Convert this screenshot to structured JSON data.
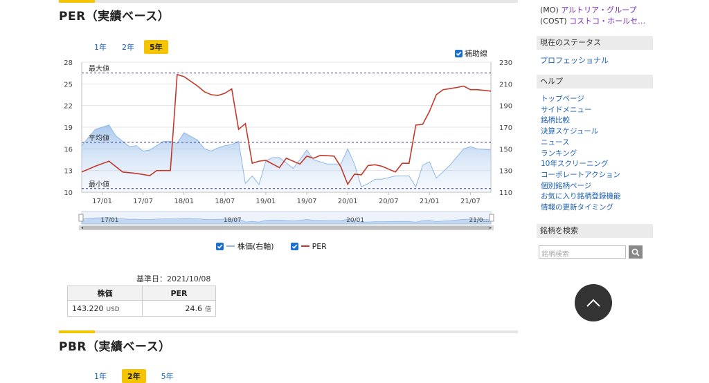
{
  "per_section": {
    "title": "PER（実績ベース）",
    "period_tabs": [
      "1年",
      "2年",
      "5年"
    ],
    "active_tab": "5年",
    "aux_line_label": "補助線",
    "legend": {
      "price": "株価(右軸)",
      "per": "PER"
    },
    "base_date": "基準日：2021/10/08",
    "table": {
      "headers": [
        "株価",
        "PER"
      ],
      "price": "143.220",
      "price_unit": "USD",
      "per": "24.6",
      "per_unit": "倍"
    }
  },
  "pbr_section": {
    "title": "PBR（実績ベース）",
    "period_tabs": [
      "1年",
      "2年",
      "5年"
    ],
    "active_tab": "2年"
  },
  "sidebar": {
    "stocks": [
      {
        "code": "(MO)",
        "name": "アルトリア・グループ"
      },
      {
        "code": "(COST)",
        "name": "コストコ・ホールセ…"
      }
    ],
    "status": {
      "title": "現在のステータス",
      "value": "プロフェッショナル"
    },
    "help": {
      "title": "ヘルプ",
      "links": [
        "トップページ",
        "サイドメニュー",
        "銘柄比較",
        "決算スケジュール",
        "ニュース",
        "ランキング",
        "10年スクリーニング",
        "コーポレートアクション",
        "個別銘柄ページ",
        "お気に入り銘柄登録機能",
        "情報の更新タイミング"
      ]
    },
    "search": {
      "title": "銘柄を検索",
      "placeholder": "銘柄検索"
    }
  },
  "colors": {
    "per_line": "#c0392b",
    "price_line": "#8fb8e8",
    "price_fill": "#dce9f9",
    "accent": "#f5c400",
    "link": "#1a5fb4"
  },
  "chart_data": {
    "type": "line",
    "x_tick_labels": [
      "17/01",
      "17/07",
      "18/01",
      "18/07",
      "19/01",
      "19/07",
      "20/01",
      "20/07",
      "21/01",
      "21/07"
    ],
    "x_range": [
      "2016-10",
      "2021-10"
    ],
    "y_left": {
      "ticks": [
        10,
        13,
        16,
        19,
        22,
        25,
        28
      ],
      "range": [
        10,
        28
      ]
    },
    "y_right": {
      "ticks": [
        110,
        130,
        150,
        170,
        190,
        210,
        230
      ],
      "range": [
        110,
        230
      ]
    },
    "reference_lines": [
      {
        "label": "最大値",
        "value": 26.5
      },
      {
        "label": "平均値",
        "value": 16.9
      },
      {
        "label": "最小値",
        "value": 10.5
      }
    ],
    "series": [
      {
        "name": "株価(右軸)",
        "axis": "right",
        "type": "area",
        "x": [
          "2016-10",
          "2016-12",
          "2017-02",
          "2017-03",
          "2017-05",
          "2017-06",
          "2017-07",
          "2017-08",
          "2017-10",
          "2017-11",
          "2017-12",
          "2018-01",
          "2018-03",
          "2018-04",
          "2018-05",
          "2018-06",
          "2018-07",
          "2018-08",
          "2018-09",
          "2018-10",
          "2018-11",
          "2018-12",
          "2019-01",
          "2019-02",
          "2019-03",
          "2019-05",
          "2019-06",
          "2019-07",
          "2019-08",
          "2019-10",
          "2019-12",
          "2020-01",
          "2020-02",
          "2020-03",
          "2020-04",
          "2020-05",
          "2020-06",
          "2020-08",
          "2020-10",
          "2020-11",
          "2020-12",
          "2021-01",
          "2021-02",
          "2021-04",
          "2021-06",
          "2021-07",
          "2021-08",
          "2021-10"
        ],
        "values": [
          153,
          168,
          172,
          162,
          152,
          153,
          148,
          149,
          157,
          157,
          155,
          165,
          158,
          150,
          148,
          151,
          153,
          154,
          157,
          118,
          125,
          117,
          139,
          142,
          142,
          132,
          140,
          149,
          140,
          136,
          136,
          150,
          136,
          115,
          118,
          122,
          122,
          125,
          125,
          115,
          135,
          138,
          123,
          135,
          150,
          152,
          150,
          149
        ]
      },
      {
        "name": "PER",
        "axis": "left",
        "type": "line",
        "x": [
          "2016-10",
          "2016-12",
          "2017-02",
          "2017-04",
          "2017-06",
          "2017-08",
          "2017-09",
          "2017-11",
          "2017-12",
          "2018-01",
          "2018-03",
          "2018-04",
          "2018-05",
          "2018-06",
          "2018-07",
          "2018-08",
          "2018-09",
          "2018-10",
          "2018-11",
          "2018-12",
          "2019-01",
          "2019-03",
          "2019-04",
          "2019-06",
          "2019-07",
          "2019-08",
          "2019-09",
          "2019-11",
          "2019-12",
          "2020-01",
          "2020-02",
          "2020-03",
          "2020-04",
          "2020-05",
          "2020-06",
          "2020-08",
          "2020-09",
          "2020-10",
          "2020-11",
          "2020-12",
          "2021-01",
          "2021-02",
          "2021-03",
          "2021-05",
          "2021-06",
          "2021-07",
          "2021-08",
          "2021-10"
        ],
        "values": [
          12.8,
          13.6,
          14.3,
          12.8,
          12.6,
          12.3,
          13.0,
          13.0,
          26.3,
          26.0,
          24.7,
          23.9,
          23.5,
          23.4,
          23.7,
          24.3,
          18.7,
          19.5,
          14.0,
          14.3,
          14.4,
          13.4,
          14.7,
          13.9,
          15.0,
          14.7,
          15.1,
          15.0,
          13.5,
          11.1,
          12.5,
          12.4,
          13.7,
          13.8,
          13.6,
          12.8,
          14.0,
          14.0,
          19.3,
          19.4,
          21.2,
          23.5,
          24.2,
          24.5,
          24.7,
          24.2,
          24.2,
          24.0
        ]
      }
    ],
    "navigator_labels": [
      "17/01",
      "18/07",
      "20/01",
      "21/0…"
    ],
    "grid": true,
    "legend_position": "bottom"
  }
}
